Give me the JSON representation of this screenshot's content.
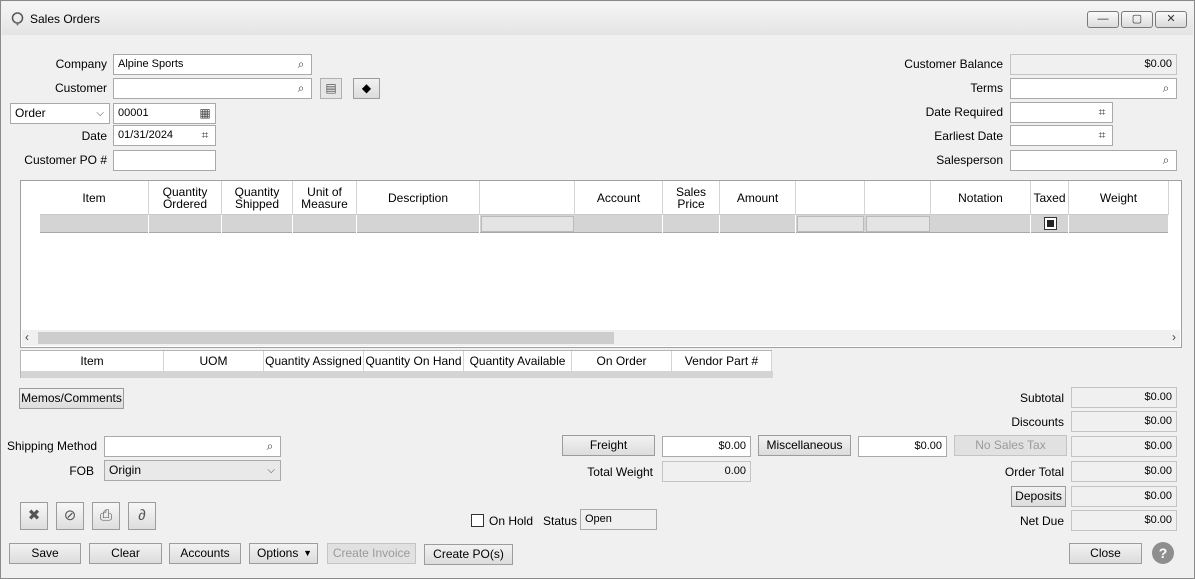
{
  "window": {
    "title": "Sales Orders",
    "min_label": "—",
    "max_label": "▢",
    "close_label": "✕"
  },
  "header": {
    "company_label": "Company",
    "company_value": "Alpine Sports",
    "customer_label": "Customer",
    "customer_value": "",
    "doc_type": "Order",
    "doc_number": "00001",
    "date_label": "Date",
    "date_value": "01/31/2024",
    "customer_po_label": "Customer PO #",
    "customer_po_value": "",
    "customer_balance_label": "Customer Balance",
    "customer_balance_value": "$0.00",
    "terms_label": "Terms",
    "date_required_label": "Date Required",
    "earliest_date_label": "Earliest Date",
    "salesperson_label": "Salesperson"
  },
  "lines_grid": {
    "columns": [
      "Item",
      "Quantity\nOrdered",
      "Quantity\nShipped",
      "Unit of\nMeasure",
      "Description",
      "",
      "Account",
      "Sales\nPrice",
      "Amount",
      "",
      "",
      "Notation",
      "Taxed",
      "Weight"
    ]
  },
  "stock_grid": {
    "columns": [
      "Item",
      "UOM",
      "Quantity Assigned",
      "Quantity On Hand",
      "Quantity Available",
      "On Order",
      "Vendor Part #"
    ]
  },
  "buttons": {
    "memos": "Memos/Comments",
    "freight": "Freight",
    "miscellaneous": "Miscellaneous",
    "no_sales_tax": "No Sales Tax",
    "deposits": "Deposits",
    "save": "Save",
    "clear": "Clear",
    "accounts": "Accounts",
    "options": "Options",
    "create_invoice": "Create Invoice",
    "create_pos": "Create PO(s)",
    "close": "Close"
  },
  "shipping": {
    "method_label": "Shipping Method",
    "method_value": "",
    "fob_label": "FOB",
    "fob_value": "Origin"
  },
  "charges": {
    "freight_value": "$0.00",
    "misc_value": "$0.00",
    "total_weight_label": "Total Weight",
    "total_weight_value": "0.00"
  },
  "status": {
    "on_hold_label": "On Hold",
    "status_label": "Status",
    "status_value": "Open"
  },
  "totals": {
    "subtotal_label": "Subtotal",
    "subtotal_value": "$0.00",
    "discounts_label": "Discounts",
    "discounts_value": "$0.00",
    "tax_value": "$0.00",
    "order_total_label": "Order Total",
    "order_total_value": "$0.00",
    "deposits_value": "$0.00",
    "net_due_label": "Net Due",
    "net_due_value": "$0.00"
  },
  "icons": {
    "magnifier": "⌕",
    "calendar": "▦",
    "grid_calendar": "⌗",
    "dropdown": "⌵",
    "help": "?"
  }
}
